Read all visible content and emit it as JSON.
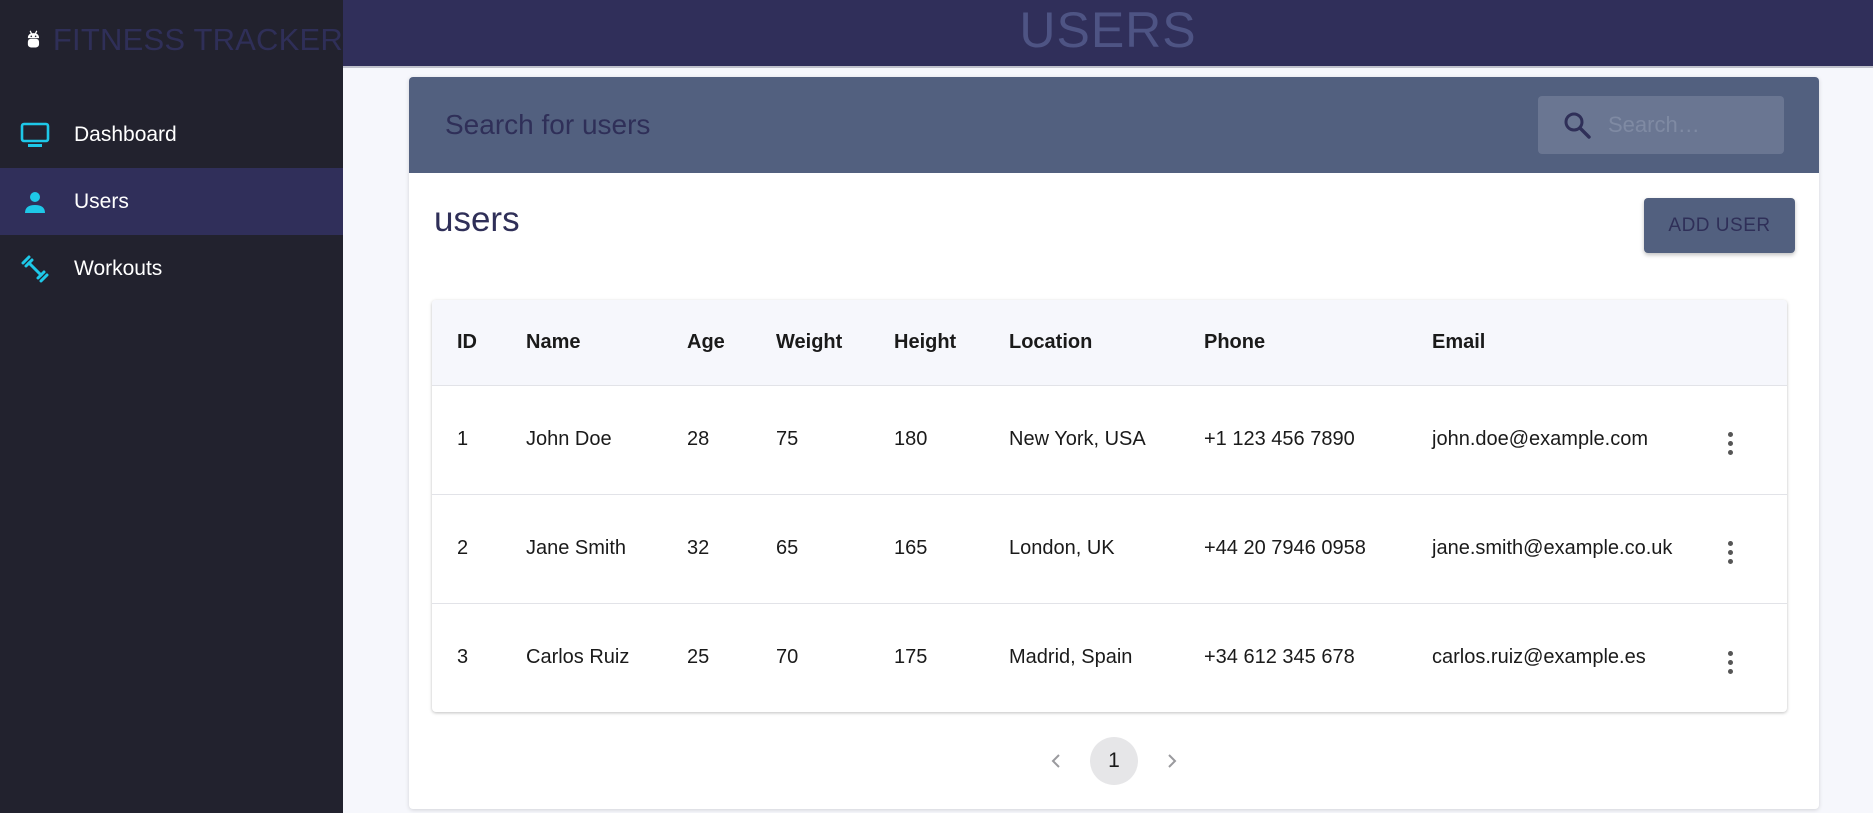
{
  "app": {
    "title": "FITNESS TRACKER",
    "logo_icon": "android-robot-icon"
  },
  "sidebar": {
    "items": [
      {
        "label": "Dashboard",
        "icon": "monitor-icon",
        "active": false
      },
      {
        "label": "Users",
        "icon": "person-icon",
        "active": true
      },
      {
        "label": "Workouts",
        "icon": "dumbbell-icon",
        "active": false
      }
    ]
  },
  "header": {
    "title": "USERS"
  },
  "search": {
    "heading": "Search for users",
    "placeholder": "Search…",
    "value": ""
  },
  "main": {
    "section_title": "users",
    "add_button": "ADD USER"
  },
  "table": {
    "columns": [
      "ID",
      "Name",
      "Age",
      "Weight",
      "Height",
      "Location",
      "Phone",
      "Email"
    ],
    "rows": [
      {
        "id": "1",
        "name": "John Doe",
        "age": "28",
        "weight": "75",
        "height": "180",
        "location": "New York, USA",
        "phone": "+1 123 456 7890",
        "email": "john.doe@example.com"
      },
      {
        "id": "2",
        "name": "Jane Smith",
        "age": "32",
        "weight": "65",
        "height": "165",
        "location": "London, UK",
        "phone": "+44 20 7946 0958",
        "email": "jane.smith@example.co.uk"
      },
      {
        "id": "3",
        "name": "Carlos Ruiz",
        "age": "25",
        "weight": "70",
        "height": "175",
        "location": "Madrid, Spain",
        "phone": "+34 612 345 678",
        "email": "carlos.ruiz@example.es"
      }
    ]
  },
  "pagination": {
    "current_page": "1"
  },
  "colors": {
    "sidebar_bg": "#22222e",
    "active_bg": "#302f5a",
    "accent_icon": "#1ec8e8",
    "card_header_bg": "#52607f"
  }
}
